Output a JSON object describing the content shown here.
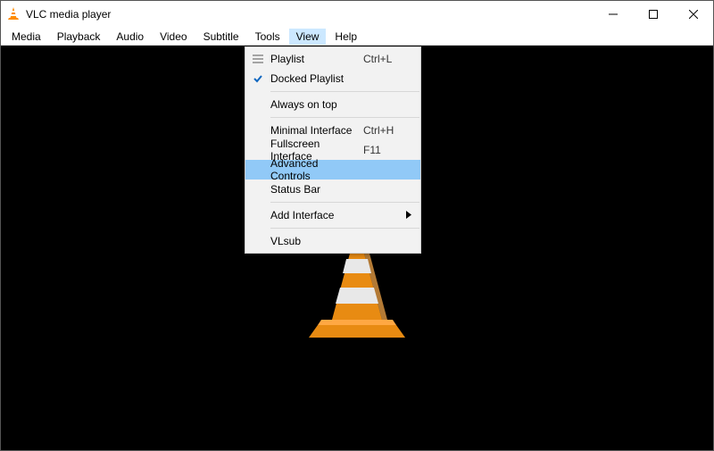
{
  "window": {
    "title": "VLC media player"
  },
  "menubar": {
    "items": [
      {
        "label": "Media"
      },
      {
        "label": "Playback"
      },
      {
        "label": "Audio"
      },
      {
        "label": "Video"
      },
      {
        "label": "Subtitle"
      },
      {
        "label": "Tools"
      },
      {
        "label": "View",
        "open": true
      },
      {
        "label": "Help"
      }
    ]
  },
  "view_menu": {
    "items": [
      {
        "label": "Playlist",
        "accel": "Ctrl+L",
        "icon": "playlist",
        "checked": false,
        "submenu": false,
        "highlight": false,
        "sep_after": false
      },
      {
        "label": "Docked Playlist",
        "accel": "",
        "icon": "check",
        "checked": true,
        "submenu": false,
        "highlight": false,
        "sep_after": true
      },
      {
        "label": "Always on top",
        "accel": "",
        "icon": "none",
        "checked": false,
        "submenu": false,
        "highlight": false,
        "sep_after": true
      },
      {
        "label": "Minimal Interface",
        "accel": "Ctrl+H",
        "icon": "none",
        "checked": false,
        "submenu": false,
        "highlight": false,
        "sep_after": false
      },
      {
        "label": "Fullscreen Interface",
        "accel": "F11",
        "icon": "none",
        "checked": false,
        "submenu": false,
        "highlight": false,
        "sep_after": false
      },
      {
        "label": "Advanced Controls",
        "accel": "",
        "icon": "none",
        "checked": false,
        "submenu": false,
        "highlight": true,
        "sep_after": false
      },
      {
        "label": "Status Bar",
        "accel": "",
        "icon": "none",
        "checked": false,
        "submenu": false,
        "highlight": false,
        "sep_after": true
      },
      {
        "label": "Add Interface",
        "accel": "",
        "icon": "none",
        "checked": false,
        "submenu": true,
        "highlight": false,
        "sep_after": true
      },
      {
        "label": "VLsub",
        "accel": "",
        "icon": "none",
        "checked": false,
        "submenu": false,
        "highlight": false,
        "sep_after": false
      }
    ]
  }
}
